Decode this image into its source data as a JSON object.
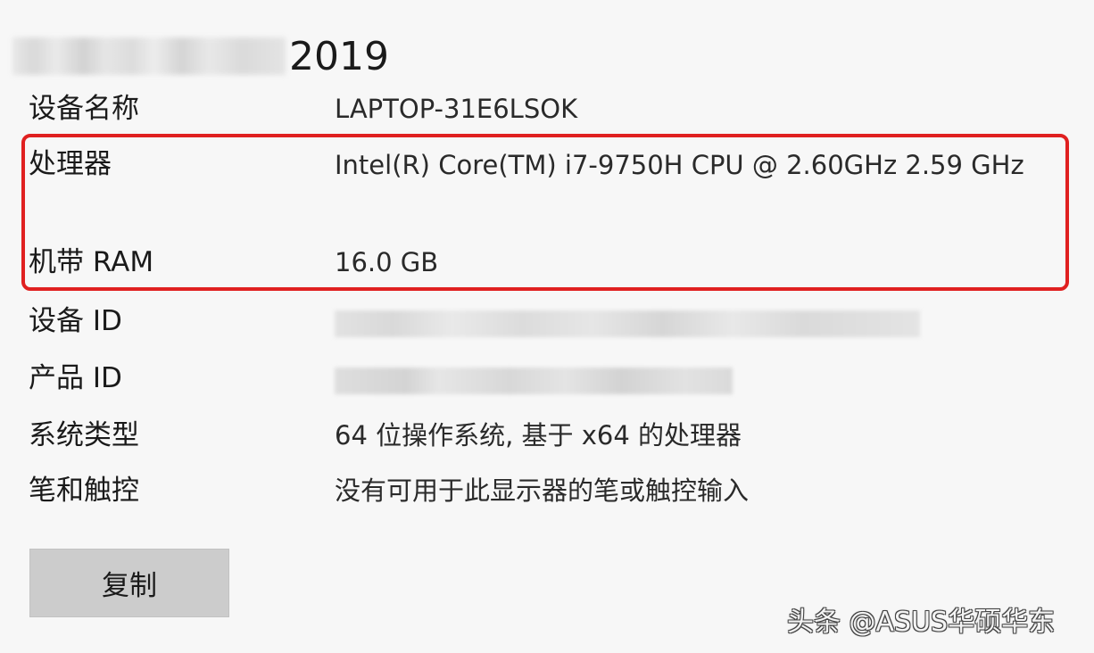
{
  "header": {
    "title_visible": "2019"
  },
  "specs": {
    "device_name": {
      "label": "设备名称",
      "value": "LAPTOP-31E6LSOK"
    },
    "processor": {
      "label": "处理器",
      "value": "Intel(R) Core(TM) i7-9750H CPU @ 2.60GHz   2.59 GHz"
    },
    "ram": {
      "label": "机带 RAM",
      "value": "16.0 GB"
    },
    "device_id": {
      "label": "设备 ID"
    },
    "product_id": {
      "label": "产品 ID"
    },
    "system_type": {
      "label": "系统类型",
      "value": "64 位操作系统, 基于 x64 的处理器"
    },
    "pen_touch": {
      "label": "笔和触控",
      "value": "没有可用于此显示器的笔或触控输入"
    }
  },
  "actions": {
    "copy_label": "复制"
  },
  "watermark": {
    "text": "头条 @ASUS华硕华东"
  },
  "colors": {
    "highlight_border": "#e02020",
    "button_bg": "#cccccc",
    "page_bg": "#f7f7f7"
  }
}
